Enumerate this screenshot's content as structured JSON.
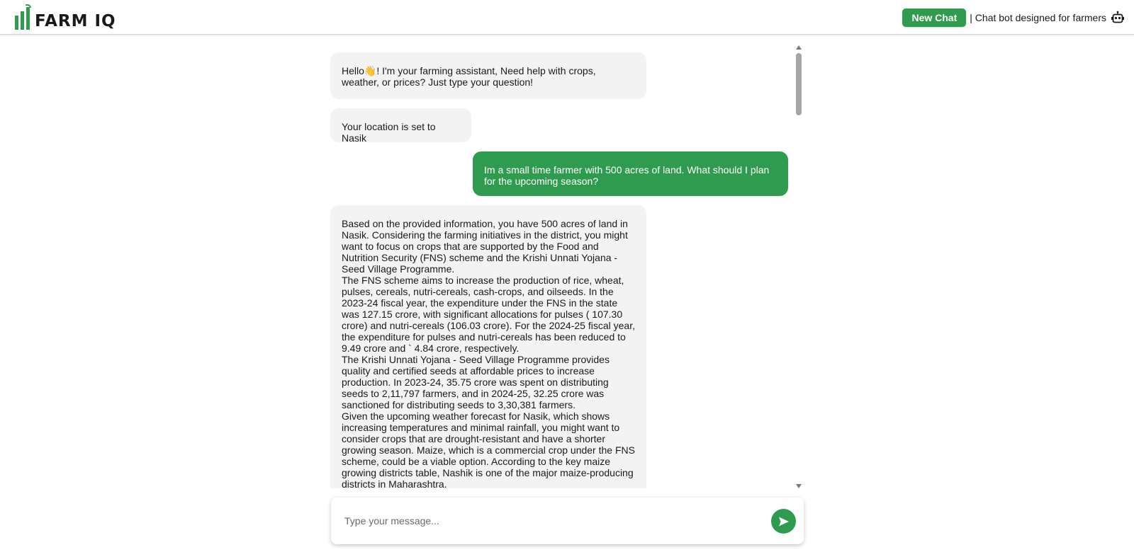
{
  "header": {
    "logo_text": "FARM IQ",
    "new_chat_label": "New Chat",
    "tagline": "| Chat bot designed for farmers",
    "robot_icon": "robot-icon"
  },
  "messages": [
    {
      "role": "bot",
      "text": "Hello👋! I'm your farming assistant, Need help with crops, weather, or prices? Just type your question!"
    },
    {
      "role": "bot",
      "text": "Your location is set to Nasik"
    },
    {
      "role": "user",
      "text": "Im a small time farmer with 500 acres of land. What should I plan for the upcoming season?"
    },
    {
      "role": "bot",
      "paragraphs": [
        "Based on the provided information, you have 500 acres of land in Nasik. Considering the farming initiatives in the district, you might want to focus on crops that are supported by the Food and Nutrition Security (FNS) scheme and the Krishi Unnati Yojana - Seed Village Programme.",
        "The FNS scheme aims to increase the production of rice, wheat, pulses, cereals, nutri-cereals, cash-crops, and oilseeds. In the 2023-24 fiscal year, the expenditure under the FNS in the state was 127.15 crore, with significant allocations for pulses ( 107.30 crore) and nutri-cereals (106.03 crore). For the 2024-25 fiscal year, the expenditure for pulses and nutri-cereals has been reduced to 9.49 crore and ` 4.84 crore, respectively.",
        "The Krishi Unnati Yojana - Seed Village Programme provides quality and certified seeds at affordable prices to increase production. In 2023-24, 35.75 crore was spent on distributing seeds to 2,11,797 farmers, and in 2024-25, 32.25 crore was sanctioned for distributing seeds to 3,30,381 farmers.",
        "Given the upcoming weather forecast for Nasik, which shows increasing temperatures and minimal rainfall, you might want to consider crops that are drought-resistant and have a shorter growing season. Maize, which is a commercial crop under the FNS scheme, could be a viable option. According to the key maize growing districts table, Nashik is one of the major maize-producing districts in Maharashtra."
      ]
    }
  ],
  "composer": {
    "placeholder": "Type your message...",
    "send_icon": "send-icon"
  },
  "colors": {
    "brand_green": "#2e9b4f",
    "bot_bubble": "#f3f3f3"
  }
}
